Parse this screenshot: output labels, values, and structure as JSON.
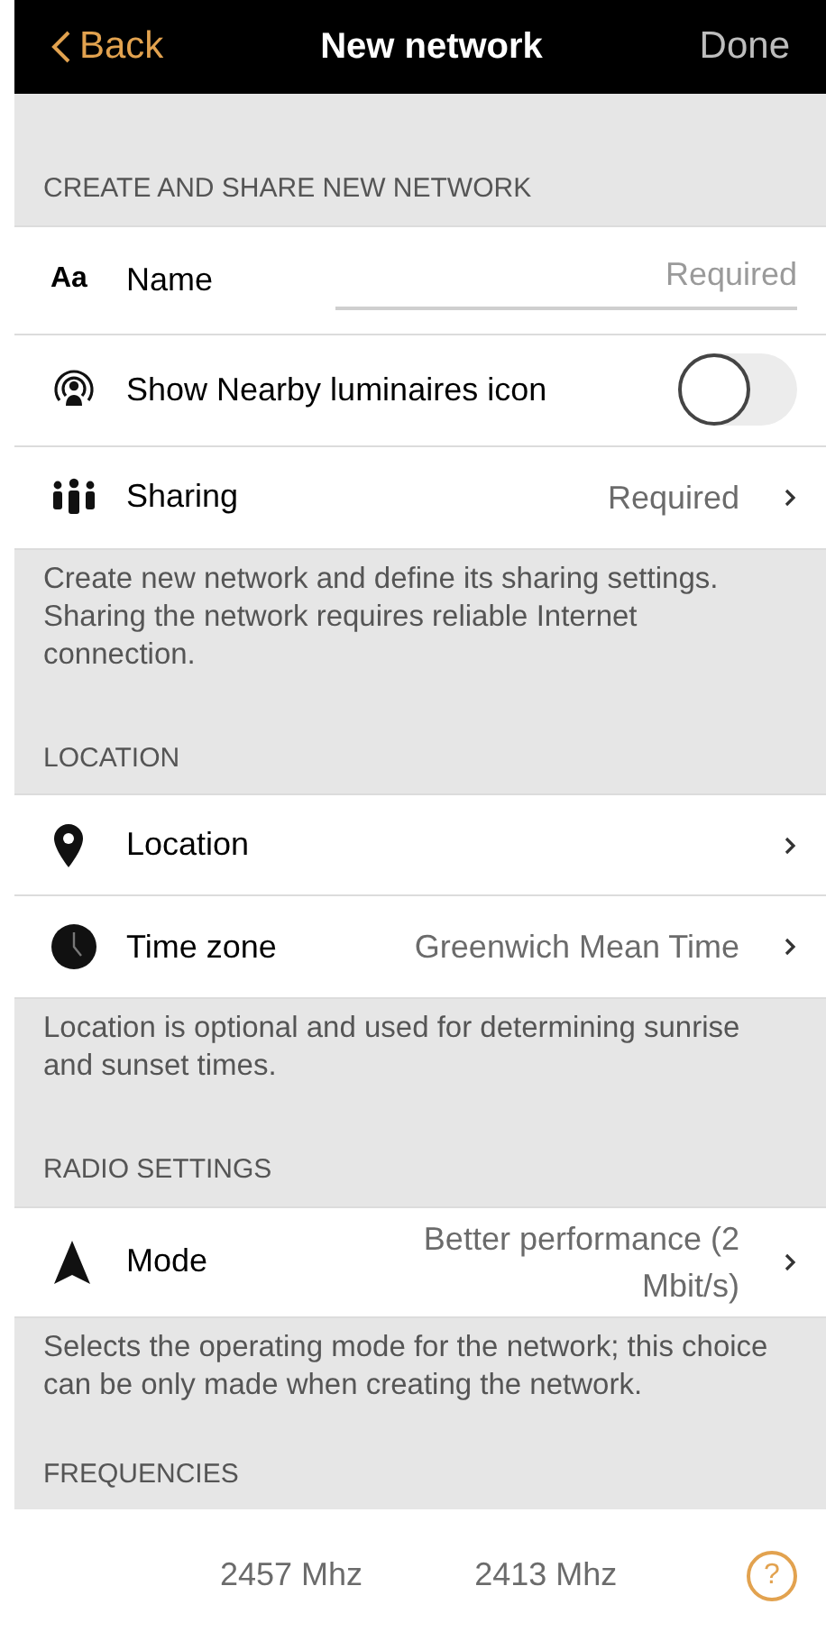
{
  "nav": {
    "back": "Back",
    "title": "New network",
    "done": "Done"
  },
  "sections": [
    {
      "header": "CREATE AND SHARE NEW NETWORK",
      "rows": [
        {
          "kind": "field",
          "icon_text": "Aa",
          "label": "Name",
          "placeholder": "Required"
        },
        {
          "kind": "toggle",
          "label": "Show Nearby luminaires icon",
          "on": false
        },
        {
          "kind": "link",
          "label": "Sharing",
          "value": "Required"
        }
      ],
      "footer": "Create new network and define its sharing settings. Sharing the network requires reliable Internet connection."
    },
    {
      "header": "LOCATION",
      "rows": [
        {
          "kind": "link",
          "label": "Location"
        },
        {
          "kind": "link",
          "label": "Time zone",
          "value": "Greenwich Mean Time"
        }
      ],
      "footer": "Location is optional and used for determining sunrise and sunset times."
    },
    {
      "header": "RADIO SETTINGS",
      "rows": [
        {
          "kind": "link",
          "label": "Mode",
          "value": "Better performance (2 Mbit/s)"
        }
      ],
      "footer": "Selects the operating mode for the network; this choice can be only made when creating the network."
    }
  ],
  "frequencies": {
    "header": "FREQUENCIES",
    "values": [
      "2457 Mhz",
      "2413 Mhz"
    ],
    "help": "?"
  }
}
